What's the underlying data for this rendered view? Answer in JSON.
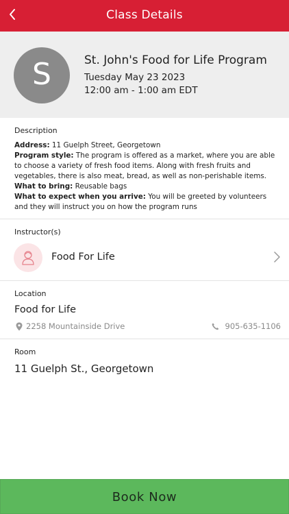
{
  "header": {
    "title": "Class Details"
  },
  "class": {
    "avatar_letter": "S",
    "name": "St. John's Food for Life Program",
    "date": "Tuesday May 23 2023",
    "time": "12:00 am - 1:00 am EDT"
  },
  "description": {
    "label": "Description",
    "address_label": "Address:",
    "address_value": " 11 Guelph Street, Georgetown",
    "style_label": "Program style:",
    "style_value": " The program is offered as a market, where you are able to choose a variety of fresh food items. Along with fresh fruits and vegetables, there is also meat, bread, as well as non-perishable items.",
    "bring_label": "What to bring:",
    "bring_value": " Reusable bags",
    "expect_label": "What to expect when you arrive:",
    "expect_value": " You will be greeted by volunteers and they will instruct you on how the program runs"
  },
  "instructors": {
    "label": "Instructor(s)",
    "name": "Food For Life"
  },
  "location": {
    "label": "Location",
    "name": "Food for Life",
    "address": "2258 Mountainside Drive",
    "phone": "905-635-1106"
  },
  "room": {
    "label": "Room",
    "name": "11 Guelph St., Georgetown"
  },
  "actions": {
    "book_label": "Book Now"
  },
  "colors": {
    "accent": "#d71f34",
    "book": "#5cb85c",
    "header_bg": "#eeeeee"
  },
  "icons": [
    "back-chevron-icon",
    "person-icon",
    "chevron-right-icon",
    "map-pin-icon",
    "phone-icon"
  ]
}
